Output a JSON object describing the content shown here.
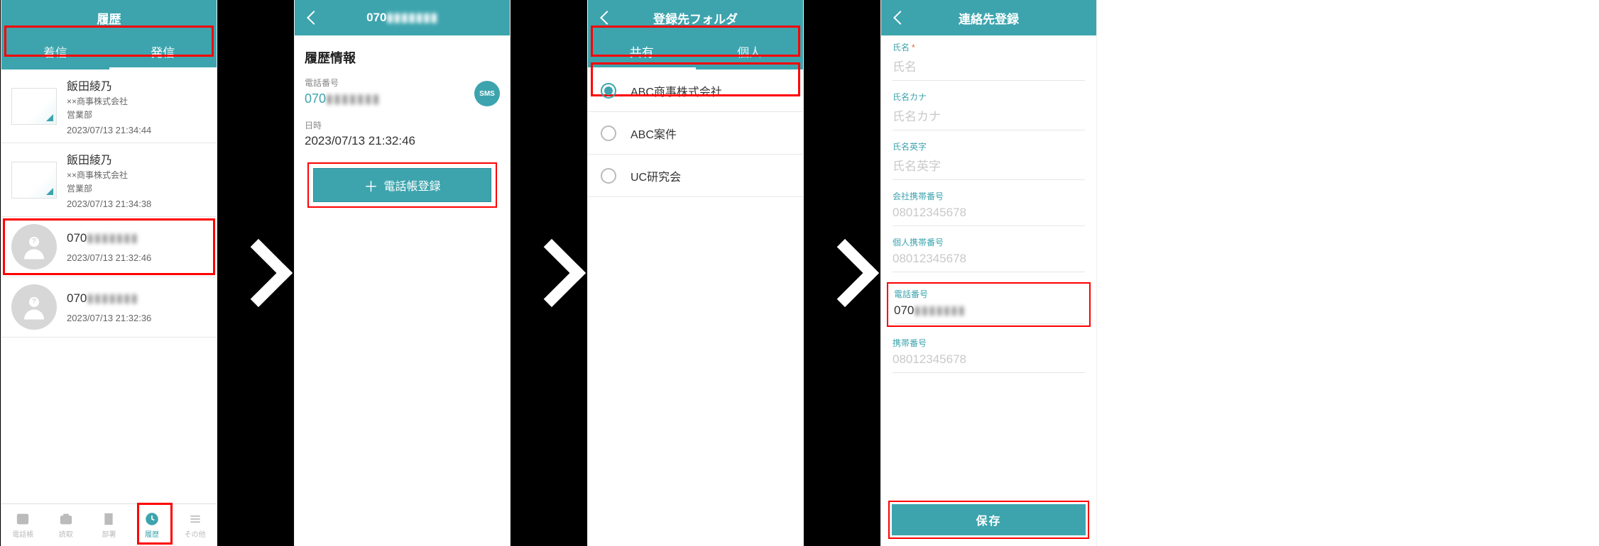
{
  "phone_masked": "070▮▮▮▮▮▮▮",
  "screen1": {
    "title": "履歴",
    "tabs": [
      "着信",
      "発信"
    ],
    "active_tab": 1,
    "items": [
      {
        "type": "card",
        "name": "飯田綾乃",
        "company": "××商事株式会社",
        "dept": "営業部",
        "time": "2023/07/13 21:34:44"
      },
      {
        "type": "card",
        "name": "飯田綾乃",
        "company": "××商事株式会社",
        "dept": "営業部",
        "time": "2023/07/13 21:34:38"
      },
      {
        "type": "unknown",
        "name": "070▮▮▮▮▮▮▮",
        "time": "2023/07/13 21:32:46"
      },
      {
        "type": "unknown",
        "name": "070▮▮▮▮▮▮▮",
        "time": "2023/07/13 21:32:36"
      }
    ],
    "nav": [
      {
        "label": "電話帳",
        "active": false
      },
      {
        "label": "読取",
        "active": false
      },
      {
        "label": "部署",
        "active": false
      },
      {
        "label": "履歴",
        "active": true
      },
      {
        "label": "その他",
        "active": false
      }
    ]
  },
  "screen2": {
    "title": "070▮▮▮▮▮▮▮",
    "section": "履歴情報",
    "phone_label": "電話番号",
    "phone_value": "070▮▮▮▮▮▮▮",
    "date_label": "日時",
    "date_value": "2023/07/13 21:32:46",
    "sms_label": "SMS",
    "button": "電話帳登録"
  },
  "screen3": {
    "title": "登録先フォルダ",
    "tabs": [
      "共有",
      "個人"
    ],
    "active_tab": 0,
    "options": [
      {
        "label": "ABC商事株式会社",
        "selected": true
      },
      {
        "label": "ABC案件",
        "selected": false
      },
      {
        "label": "UC研究会",
        "selected": false
      }
    ]
  },
  "screen4": {
    "title": "連絡先登録",
    "fields": [
      {
        "label": "氏名",
        "placeholder": "氏名",
        "required": true
      },
      {
        "label": "氏名カナ",
        "placeholder": "氏名カナ"
      },
      {
        "label": "氏名英字",
        "placeholder": "氏名英字"
      },
      {
        "label": "会社携帯番号",
        "placeholder": "08012345678"
      },
      {
        "label": "個人携帯番号",
        "placeholder": "08012345678"
      },
      {
        "label": "電話番号",
        "value": "070▮▮▮▮▮▮▮",
        "filled": true
      },
      {
        "label": "携帯番号",
        "placeholder": "08012345678"
      }
    ],
    "save": "保存"
  }
}
